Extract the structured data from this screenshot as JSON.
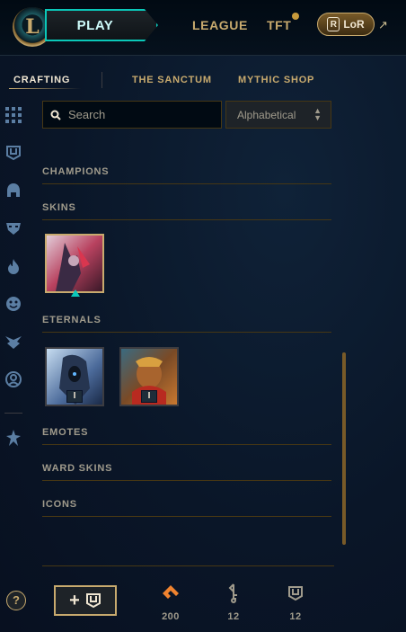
{
  "topbar": {
    "logo_letter": "L",
    "play_label": "PLAY",
    "league_label": "LEAGUE",
    "tft_label": "TFT",
    "lor_label": "LoR",
    "lor_glyph": "R",
    "external_arrow": "↗",
    "notification_color": "#c89b3c"
  },
  "subnav": {
    "tabs": [
      {
        "label": "CRAFTING",
        "active": true
      },
      {
        "label": "THE SANCTUM",
        "active": false
      },
      {
        "label": "MYTHIC SHOP",
        "active": false
      }
    ]
  },
  "rail": {
    "icons": [
      "grid-icon",
      "chest-icon",
      "helmet-icon",
      "mask-icon",
      "flame-icon",
      "emote-icon",
      "ward-icon",
      "profile-icon",
      "divider",
      "mythic-icon"
    ]
  },
  "filters": {
    "search_placeholder": "Search",
    "sort_value": "Alphabetical"
  },
  "sections": {
    "champions": "CHAMPIONS",
    "skins": "SKINS",
    "eternals": "ETERNALS",
    "emotes": "EMOTES",
    "ward_skins": "WARD SKINS",
    "icons": "ICONS"
  },
  "eternals": {
    "items": [
      {
        "badge": "I"
      },
      {
        "badge": "I"
      }
    ]
  },
  "bottombar": {
    "help_label": "?",
    "add_chest_label": "+",
    "currencies": [
      {
        "icon": "orange-essence-icon",
        "value": "200"
      },
      {
        "icon": "key-icon",
        "value": "12"
      },
      {
        "icon": "chest-icon",
        "value": "12"
      }
    ]
  },
  "colors": {
    "gold": "#c8aa6e",
    "teal": "#0ac8b9",
    "background": "#0a1428",
    "orange_essence": "#f0832f"
  }
}
